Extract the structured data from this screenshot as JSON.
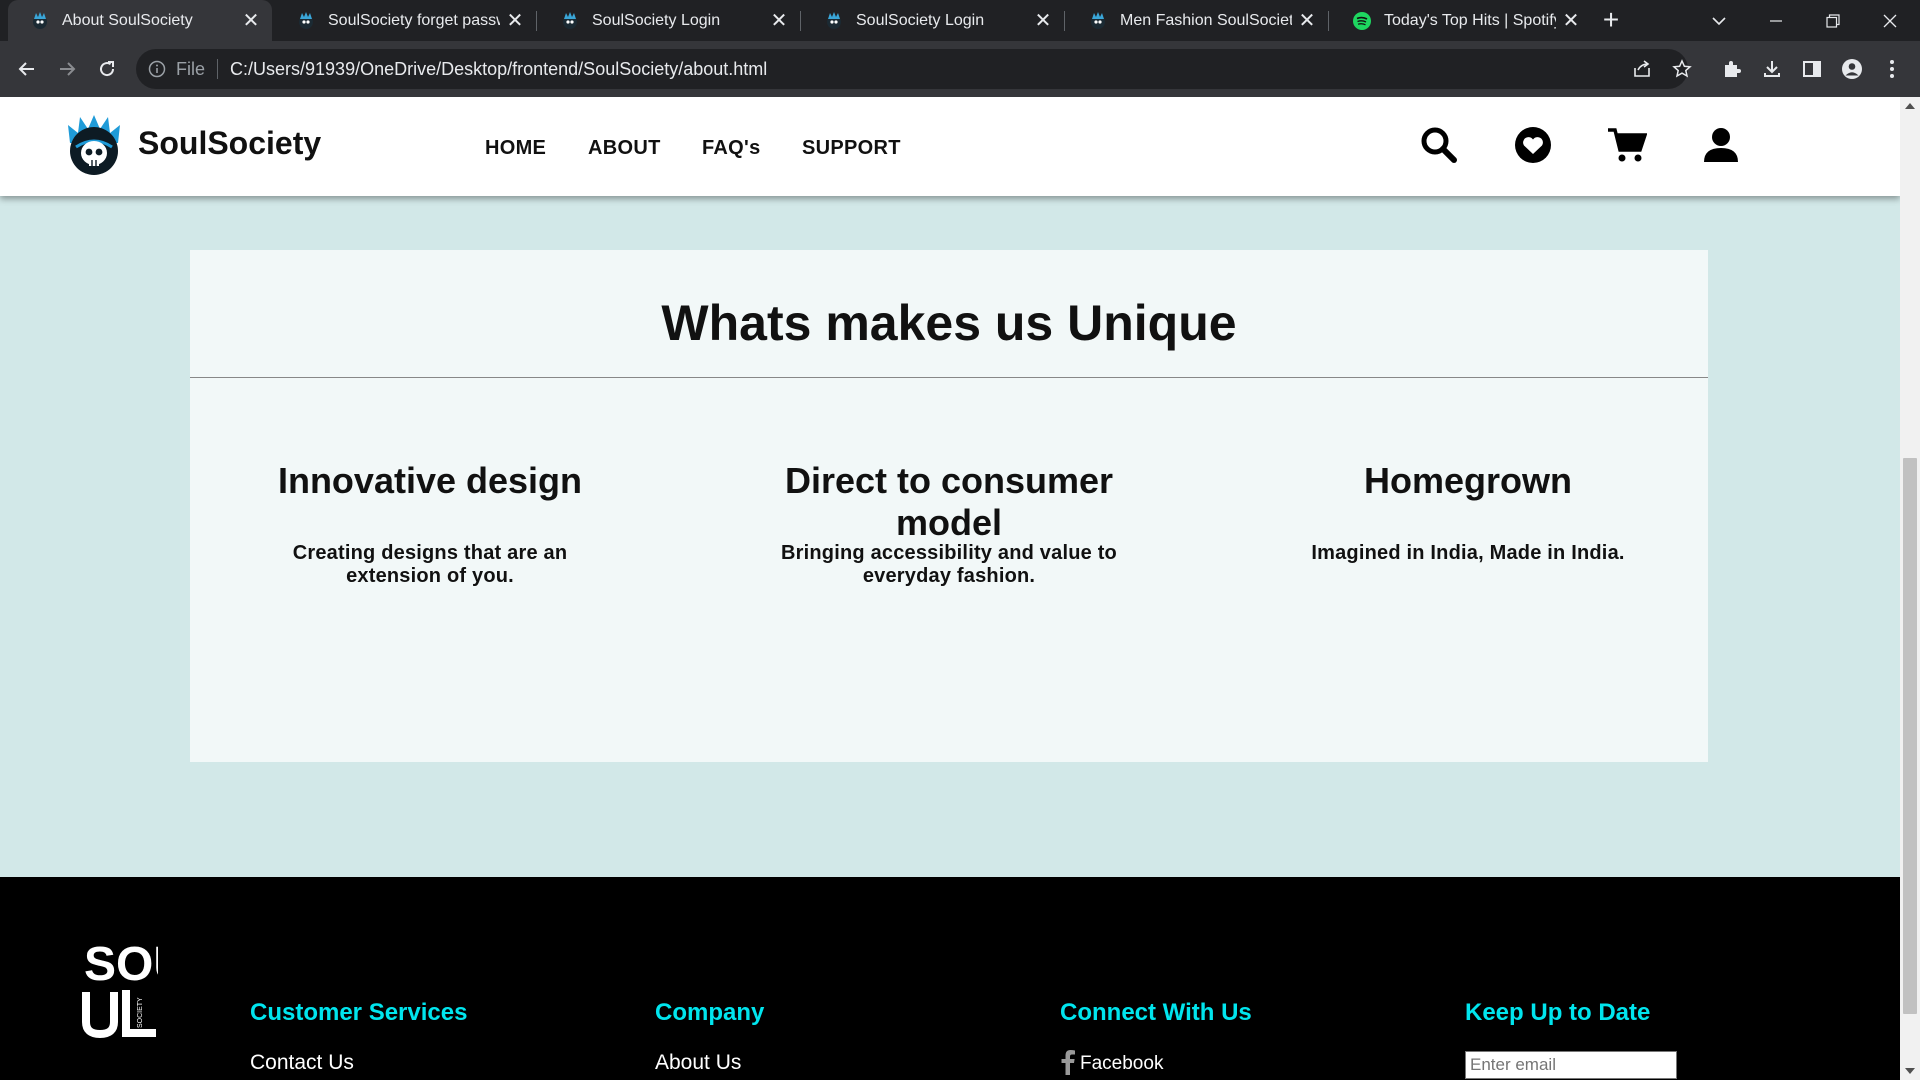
{
  "browser": {
    "tabs": [
      {
        "title": "About SoulSociety",
        "icon": "soulsociety-favicon",
        "active": true
      },
      {
        "title": "SoulSociety forget password",
        "icon": "soulsociety-favicon",
        "active": false
      },
      {
        "title": "SoulSociety Login",
        "icon": "soulsociety-favicon",
        "active": false
      },
      {
        "title": "SoulSociety Login",
        "icon": "soulsociety-favicon",
        "active": false
      },
      {
        "title": "Men Fashion SoulSociety",
        "icon": "soulsociety-favicon",
        "active": false
      },
      {
        "title": "Today's Top Hits | Spotify Playlist",
        "icon": "spotify-favicon",
        "active": false
      }
    ],
    "new_tab": "+",
    "address": {
      "scheme": "File",
      "url": "C:/Users/91939/OneDrive/Desktop/frontend/SoulSociety/about.html"
    },
    "colors": {
      "tabstrip": "#202124",
      "toolbar": "#35363a",
      "omnibox": "#202124"
    }
  },
  "site": {
    "brand": "SoulSociety",
    "nav": [
      "HOME",
      "ABOUT",
      "FAQ's",
      "SUPPORT"
    ],
    "header_icons": [
      "search-icon",
      "heart-icon",
      "cart-icon",
      "user-icon"
    ],
    "unique": {
      "title": "Whats makes us Unique",
      "features": [
        {
          "title": "Innovative design",
          "desc": "Creating designs that are an extension of you."
        },
        {
          "title": "Direct to consumer model",
          "desc": "Bringing accessibility and value to everyday fashion."
        },
        {
          "title": "Homegrown",
          "desc": "Imagined in India, Made in India."
        }
      ]
    },
    "footer": {
      "logo_text": "SOUL",
      "logo_small_text": "SOCIETY",
      "columns": [
        {
          "heading": "Customer Services",
          "link": "Contact Us"
        },
        {
          "heading": "Company",
          "link": "About Us"
        },
        {
          "heading": "Connect With Us",
          "link": "Facebook"
        },
        {
          "heading": "Keep Up to Date",
          "placeholder": "Enter email"
        }
      ]
    },
    "colors": {
      "page_bg": "#d2e8e8",
      "card_bg": "#f2f8f8",
      "footer_heading": "#00e5ee"
    }
  }
}
